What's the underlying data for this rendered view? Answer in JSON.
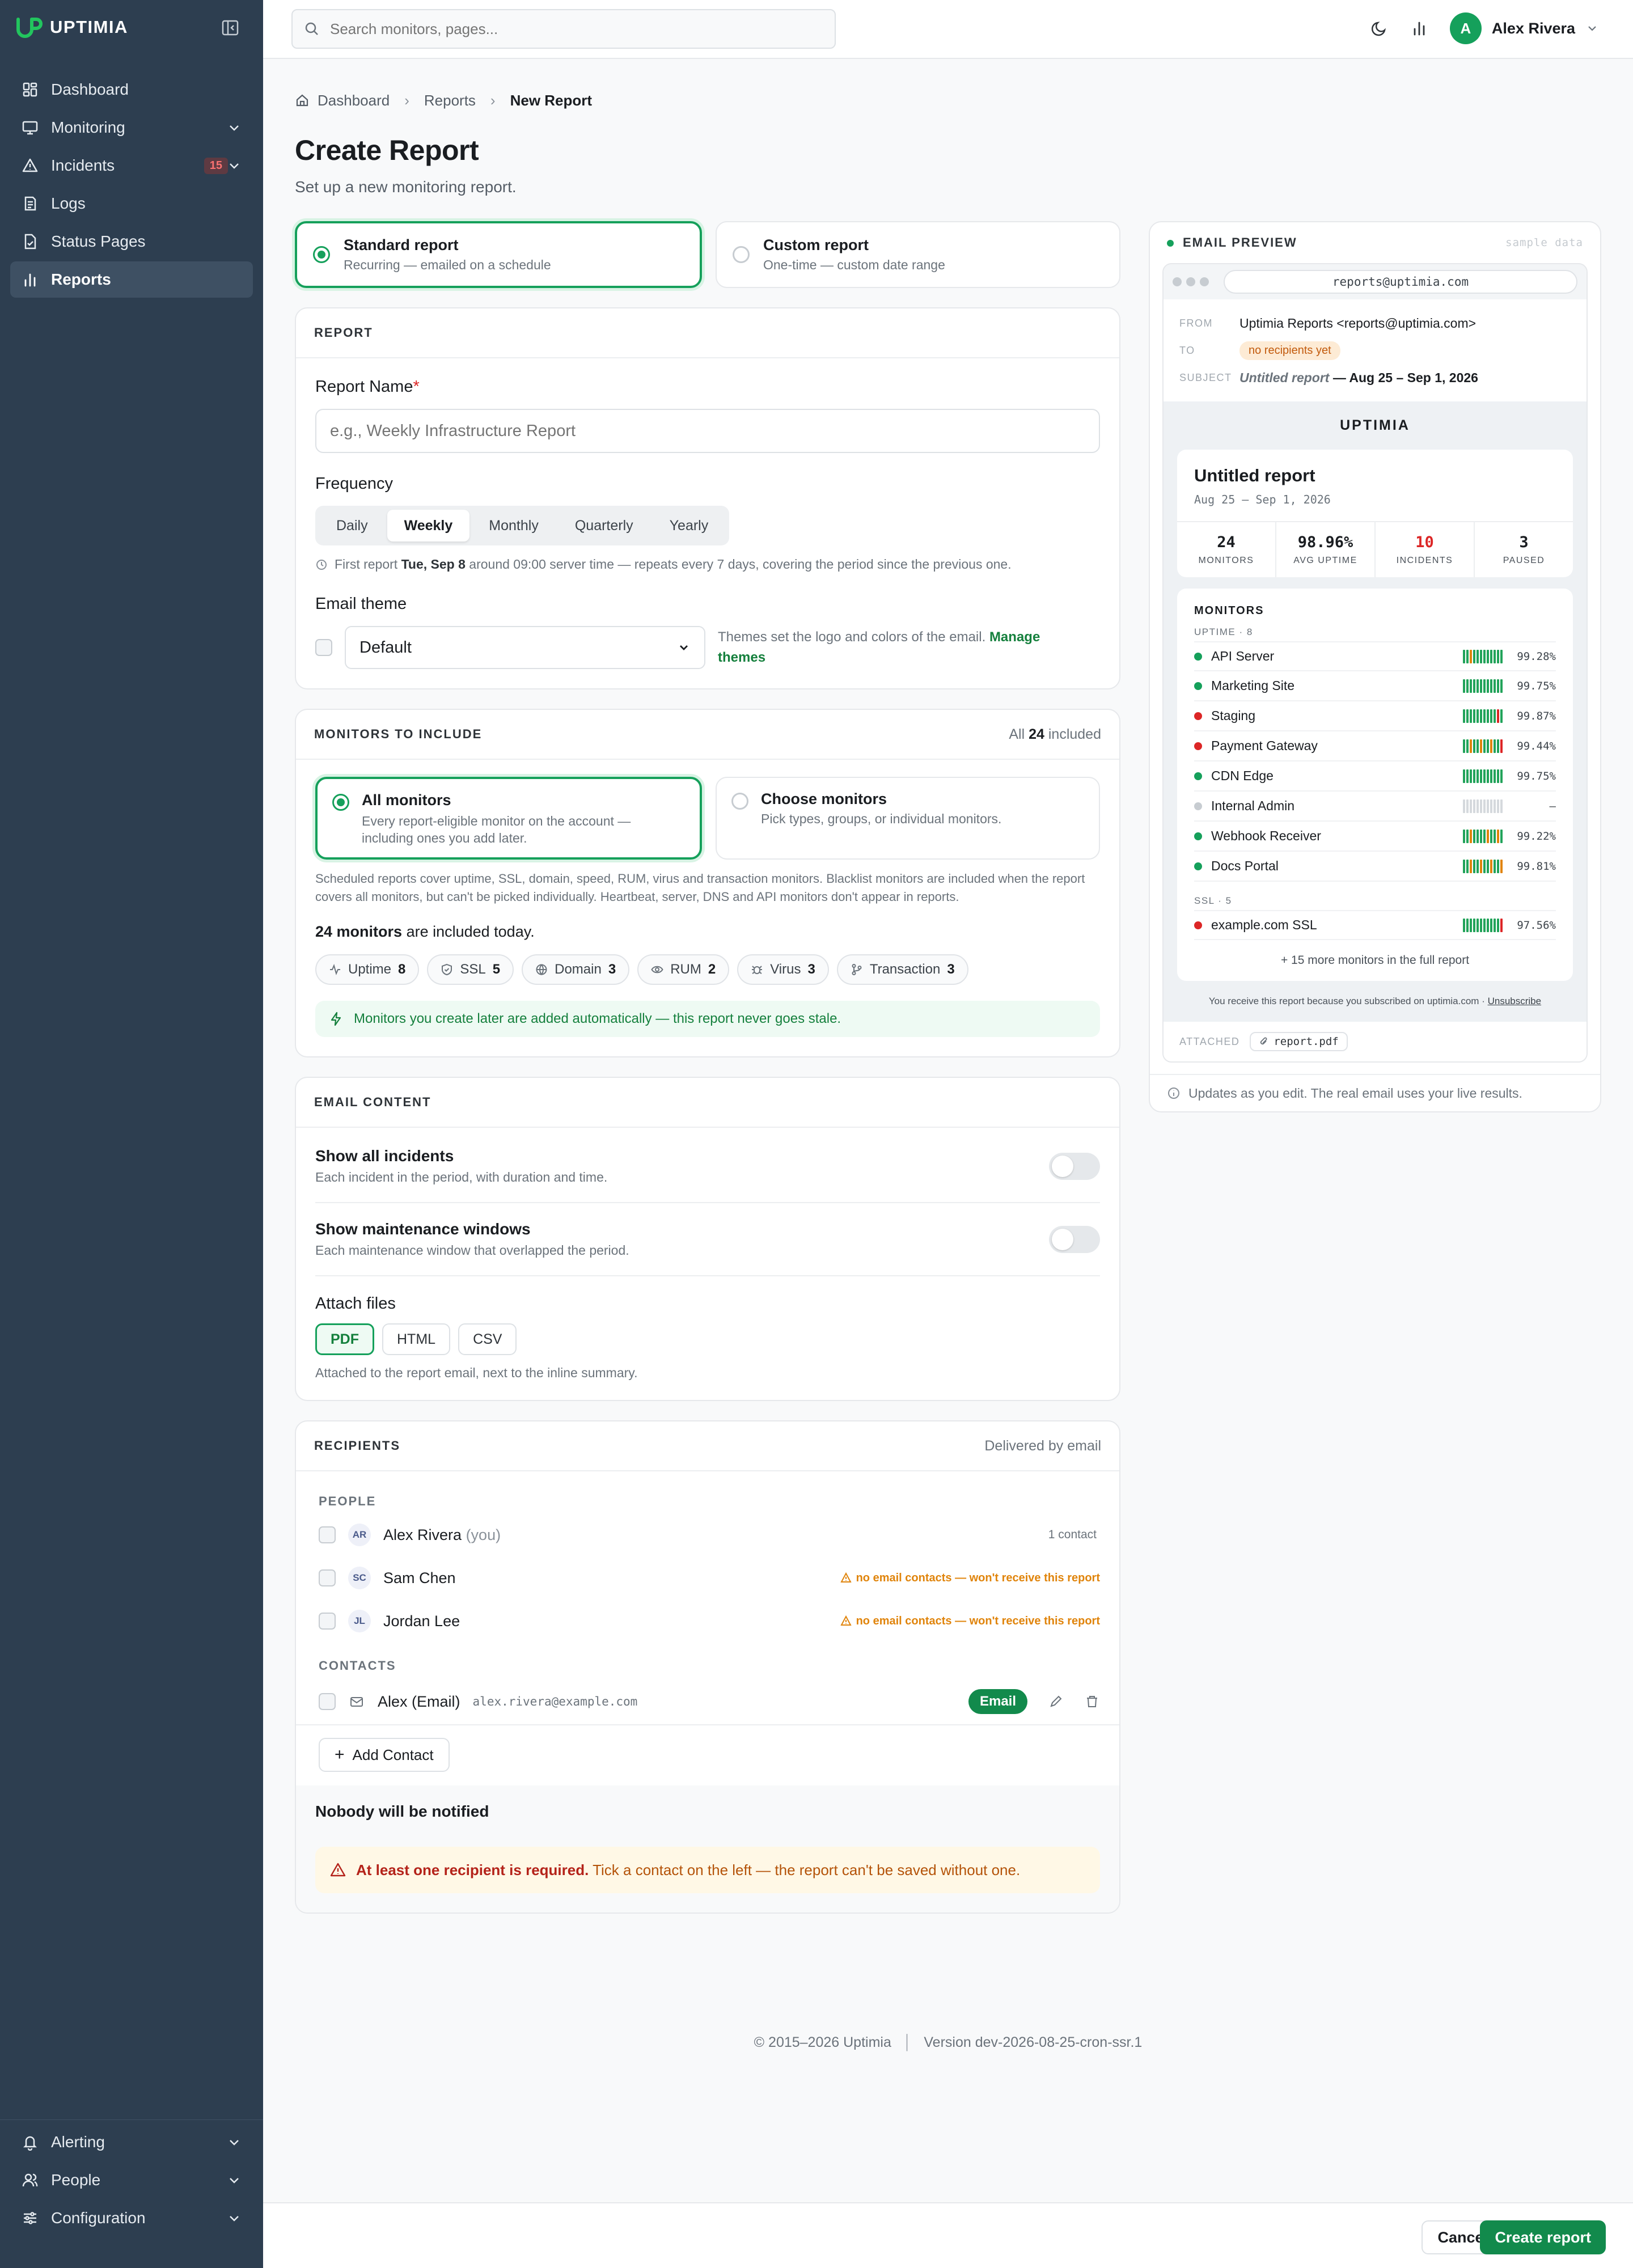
{
  "app": {
    "brand": "UPTIMIA"
  },
  "sidebar": {
    "items": [
      {
        "label": "Dashboard",
        "icon": "dashboard-icon"
      },
      {
        "label": "Monitoring",
        "icon": "monitor-icon"
      },
      {
        "label": "Incidents",
        "icon": "warning-icon",
        "badge": "15"
      },
      {
        "label": "Logs",
        "icon": "logs-icon"
      },
      {
        "label": "Status Pages",
        "icon": "status-page-icon"
      },
      {
        "label": "Reports",
        "icon": "reports-icon",
        "active": true
      }
    ],
    "bottom": [
      {
        "label": "Alerting",
        "icon": "bell-icon"
      },
      {
        "label": "People",
        "icon": "people-icon"
      },
      {
        "label": "Configuration",
        "icon": "sliders-icon"
      }
    ]
  },
  "topbar": {
    "search_placeholder": "Search monitors, pages...",
    "user_initial": "A",
    "user_name": "Alex Rivera"
  },
  "breadcrumb": {
    "home": "Dashboard",
    "parent": "Reports",
    "current": "New Report"
  },
  "page": {
    "title": "Create Report",
    "subtitle": "Set up a new monitoring report."
  },
  "report_type": {
    "standard": {
      "title": "Standard report",
      "desc": "Recurring — emailed on a schedule"
    },
    "custom": {
      "title": "Custom report",
      "desc": "One-time — custom date range"
    }
  },
  "report": {
    "section": "REPORT",
    "name_label": "Report Name",
    "name_required": "*",
    "name_placeholder": "e.g., Weekly Infrastructure Report",
    "frequency_label": "Frequency",
    "frequencies": [
      "Daily",
      "Weekly",
      "Monthly",
      "Quarterly",
      "Yearly"
    ],
    "frequency_selected": "Weekly",
    "first_report_pre": "First report",
    "first_report_date": "Tue, Sep 8",
    "first_report_post": "around 09:00 server time — repeats every 7 days, covering the period since the previous one.",
    "theme_label": "Email theme",
    "theme_value": "Default",
    "theme_note": "Themes set the logo and colors of the email.",
    "theme_link": "Manage themes"
  },
  "monitors": {
    "section": "MONITORS TO INCLUDE",
    "aside_pre": "All",
    "aside_count": "24",
    "aside_post": "included",
    "all": {
      "title": "All monitors",
      "desc": "Every report-eligible monitor on the account — including ones you add later."
    },
    "choose": {
      "title": "Choose monitors",
      "desc": "Pick types, groups, or individual monitors."
    },
    "note": "Scheduled reports cover uptime, SSL, domain, speed, RUM, virus and transaction monitors. Blacklist monitors are included when the report covers all monitors, but can't be picked individually. Heartbeat, server, DNS and API monitors don't appear in reports.",
    "count_bold": "24 monitors",
    "count_rest": "are included today.",
    "chips": [
      {
        "label": "Uptime",
        "count": "8",
        "icon": "pulse-icon"
      },
      {
        "label": "SSL",
        "count": "5",
        "icon": "shield-icon"
      },
      {
        "label": "Domain",
        "count": "3",
        "icon": "globe-icon"
      },
      {
        "label": "RUM",
        "count": "2",
        "icon": "eye-icon"
      },
      {
        "label": "Virus",
        "count": "3",
        "icon": "bug-icon"
      },
      {
        "label": "Transaction",
        "count": "3",
        "icon": "branch-icon"
      }
    ],
    "banner": "Monitors you create later are added automatically — this report never goes stale."
  },
  "content": {
    "section": "EMAIL CONTENT",
    "incidents_title": "Show all incidents",
    "incidents_desc": "Each incident in the period, with duration and time.",
    "maint_title": "Show maintenance windows",
    "maint_desc": "Each maintenance window that overlapped the period.",
    "attach_label": "Attach files",
    "files": [
      "PDF",
      "HTML",
      "CSV"
    ],
    "attach_note": "Attached to the report email, next to the inline summary."
  },
  "recipients": {
    "section": "RECIPIENTS",
    "aside": "Delivered by email",
    "people_label": "PEOPLE",
    "people": [
      {
        "initials": "AR",
        "name": "Alex Rivera",
        "suffix": "(you)",
        "status": "1 contact",
        "warn": false
      },
      {
        "initials": "SC",
        "name": "Sam Chen",
        "suffix": "",
        "status": "no email contacts — won't receive this report",
        "warn": true
      },
      {
        "initials": "JL",
        "name": "Jordan Lee",
        "suffix": "",
        "status": "no email contacts — won't receive this report",
        "warn": true
      }
    ],
    "contacts_label": "CONTACTS",
    "contact": {
      "name": "Alex (Email)",
      "email": "alex.rivera@example.com",
      "badge": "Email"
    },
    "add_contact": "Add Contact",
    "nobody": "Nobody will be notified",
    "error_bold": "At least one recipient is required.",
    "error_rest": "Tick a contact on the left — the report can't be saved without one."
  },
  "preview": {
    "title": "EMAIL PREVIEW",
    "sample": "sample data",
    "url": "reports@uptimia.com",
    "from_k": "FROM",
    "from_v": "Uptimia Reports <reports@uptimia.com>",
    "to_k": "TO",
    "to_v": "no recipients yet",
    "subject_k": "SUBJECT",
    "subject_italic": "Untitled report",
    "subject_rest": "— Aug 25 – Sep 1, 2026",
    "brand": "UPTIMIA",
    "report_title": "Untitled report",
    "report_date": "Aug 25 – Sep 1, 2026",
    "stats": [
      {
        "value": "24",
        "label": "MONITORS",
        "color": "#1a1d21"
      },
      {
        "value": "98.96%",
        "label": "AVG UPTIME",
        "color": "#1a1d21"
      },
      {
        "value": "10",
        "label": "INCIDENTS",
        "color": "#dc2626"
      },
      {
        "value": "3",
        "label": "PAUSED",
        "color": "#1a1d21"
      }
    ],
    "monitors_title": "MONITORS",
    "groups": [
      {
        "label": "UPTIME · 8",
        "rows": [
          {
            "name": "API Server",
            "pct": "99.28%",
            "status": "#15a05b",
            "bars": "ggoggggggggg"
          },
          {
            "name": "Marketing Site",
            "pct": "99.75%",
            "status": "#15a05b",
            "bars": "gggggggggggg"
          },
          {
            "name": "Staging",
            "pct": "99.87%",
            "status": "#dc2626",
            "bars": "ggggggggggr"
          },
          {
            "name": "Payment Gateway",
            "pct": "99.44%",
            "status": "#dc2626",
            "bars": "ggoggoggoggr"
          },
          {
            "name": "CDN Edge",
            "pct": "99.75%",
            "status": "#15a05b",
            "bars": "gggggggggggg"
          },
          {
            "name": "Internal Admin",
            "pct": "–",
            "status": "#c7ccd1",
            "bars": "xxxxxxxxxxxx"
          },
          {
            "name": "Webhook Receiver",
            "pct": "99.22%",
            "status": "#15a05b",
            "bars": "ggoggggoggog"
          },
          {
            "name": "Docs Portal",
            "pct": "99.81%",
            "status": "#15a05b",
            "bars": "ggoggoggoggo"
          }
        ]
      },
      {
        "label": "SSL · 5",
        "rows": [
          {
            "name": "example.com SSL",
            "pct": "97.56%",
            "status": "#dc2626",
            "bars": "gggggggggggr"
          }
        ]
      }
    ],
    "more": "+ 15 more monitors in the full report",
    "foot_text": "You receive this report because you subscribed on uptimia.com ·",
    "foot_link": "Unsubscribe",
    "attached_k": "ATTACHED",
    "attached_file": "report.pdf",
    "note": "Updates as you edit. The real email uses your live results."
  },
  "footer": {
    "copyright": "© 2015–2026 Uptimia",
    "version": "Version dev-2026-08-25-cron-ssr.1"
  },
  "actions": {
    "cancel": "Cancel",
    "create": "Create report"
  },
  "colors": {
    "accent": "#15a05b",
    "sidebar": "#2d3e50",
    "danger": "#dc2626",
    "warning": "#e0840b"
  }
}
